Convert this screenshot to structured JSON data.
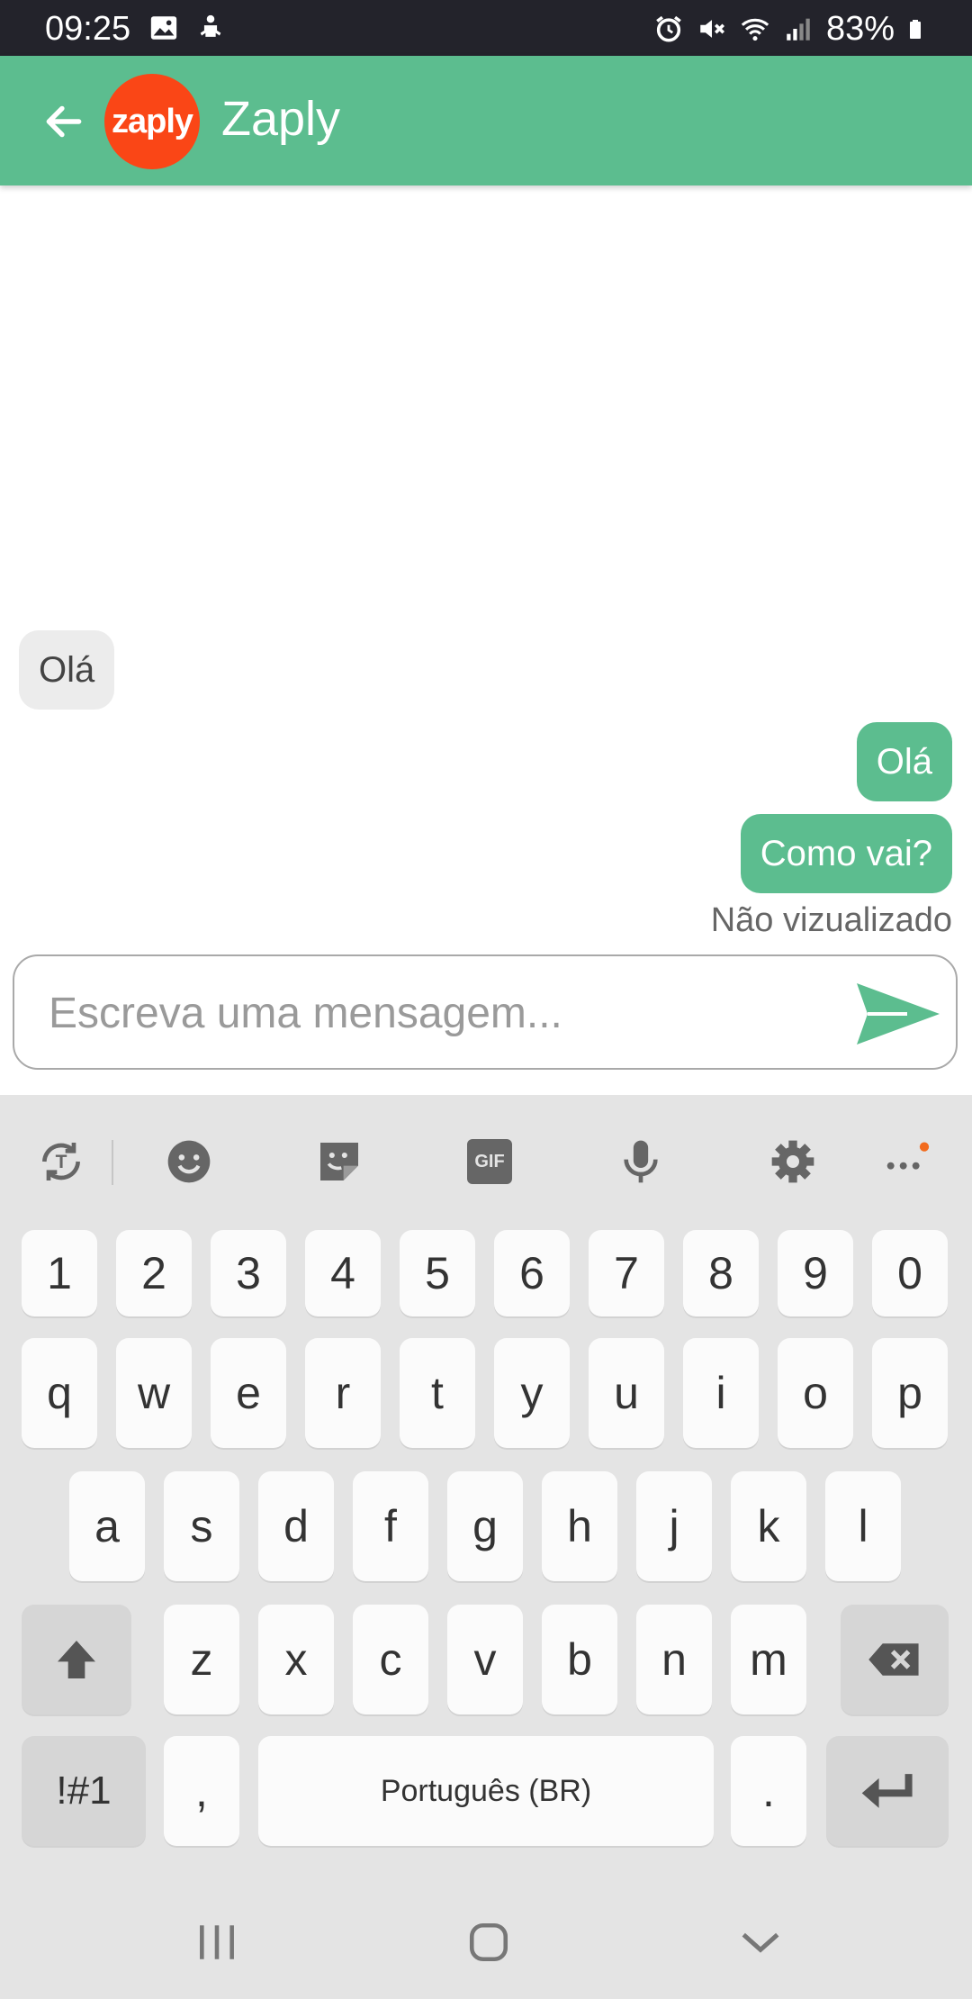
{
  "status_bar": {
    "time": "09:25",
    "battery": "83%",
    "icons": [
      "image-icon",
      "bug-icon",
      "alarm-icon",
      "mute-icon",
      "wifi-icon",
      "signal-icon",
      "battery-icon"
    ]
  },
  "header": {
    "logo_text": "zaply",
    "title": "Zaply",
    "colors": {
      "bar": "#5cbd8f",
      "logo_bg": "#fa4616"
    }
  },
  "messages": [
    {
      "direction": "incoming",
      "text": "Olá"
    },
    {
      "direction": "outgoing",
      "text": "Olá"
    },
    {
      "direction": "outgoing",
      "text": "Como vai?"
    }
  ],
  "read_status": "Não vizualizado",
  "composer": {
    "placeholder": "Escreva uma mensagem...",
    "value": "",
    "send_icon": "send-icon"
  },
  "keyboard": {
    "toolbar": [
      "translate-icon",
      "emoji-icon",
      "sticker-icon",
      "gif-icon",
      "mic-icon",
      "settings-icon",
      "more-icon"
    ],
    "gif_label": "GIF",
    "row_numbers": [
      "1",
      "2",
      "3",
      "4",
      "5",
      "6",
      "7",
      "8",
      "9",
      "0"
    ],
    "row_1": [
      "q",
      "w",
      "e",
      "r",
      "t",
      "y",
      "u",
      "i",
      "o",
      "p"
    ],
    "row_2": [
      "a",
      "s",
      "d",
      "f",
      "g",
      "h",
      "j",
      "k",
      "l"
    ],
    "row_3": [
      "z",
      "x",
      "c",
      "v",
      "b",
      "n",
      "m"
    ],
    "symbols_label": "!#1",
    "comma": ",",
    "space_label": "Português (BR)",
    "period": "."
  },
  "nav_bar": [
    "recents-icon",
    "home-icon",
    "back-chevron-icon"
  ]
}
